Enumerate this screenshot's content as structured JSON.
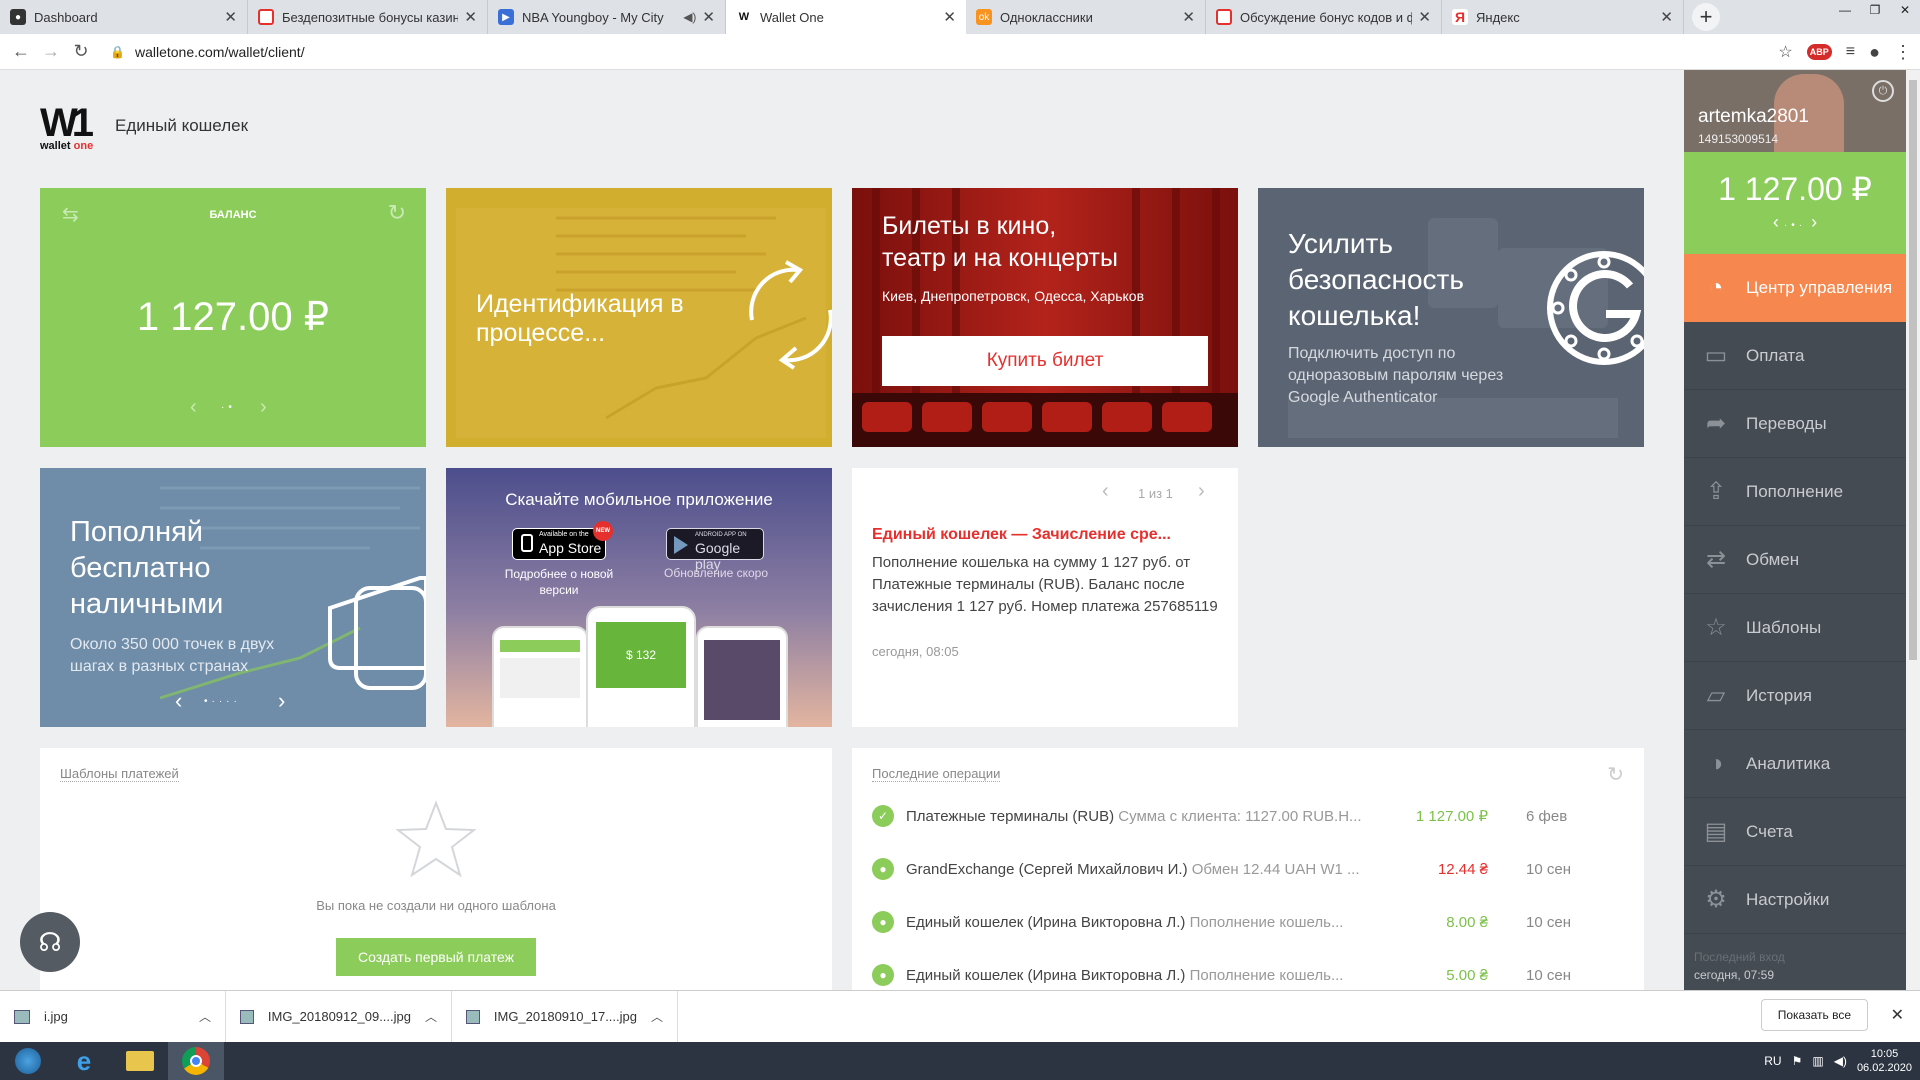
{
  "browser": {
    "tabs": [
      {
        "title": "Dashboard",
        "icon": "github-icon",
        "color": "#333333"
      },
      {
        "title": "Бездепозитные бонусы казино",
        "icon": "spinner-icon",
        "color": "#e5302d"
      },
      {
        "title": "NBA Youngboy - My City",
        "icon": "video-icon",
        "color": "#3a6fd8"
      },
      {
        "title": "Wallet One",
        "icon": "walletone-icon",
        "color": "#111111"
      },
      {
        "title": "Одноклассники",
        "icon": "ok-icon",
        "color": "#f7931e"
      },
      {
        "title": "Обсуждение бонус кодов и фр",
        "icon": "spinner-icon",
        "color": "#e5302d"
      },
      {
        "title": "Яндекс",
        "icon": "yandex-icon",
        "color": "#e5302d"
      }
    ],
    "url": "walletone.com/wallet/client/"
  },
  "header": {
    "logo_mark": "W1",
    "logo_text": "wallet",
    "logo_text_accent": "one",
    "brand": "Единый кошелек"
  },
  "tiles": {
    "balance": {
      "label": "БАЛАНС",
      "amount": "1 127.00 ₽"
    },
    "identification": {
      "text": "Идентификация в процессе..."
    },
    "tickets": {
      "title_line1": "Билеты в кино,",
      "title_line2": "театр и на концерты",
      "cities": "Киев, Днепропетровск, Одесса, Харьков",
      "button": "Купить билет"
    },
    "security": {
      "title_line1": "Усилить",
      "title_line2": "безопасность",
      "title_line3": "кошелька!",
      "text": "Подключить доступ по одноразовым паролям через Google Authenticator"
    },
    "cash": {
      "title_line1": "Пополняй",
      "title_line2": "бесплатно",
      "title_line3": "наличными",
      "text": "Около 350 000 точек в двух шагах в разных странах"
    },
    "mobile": {
      "title": "Скачайте мобильное приложение",
      "appstore_small": "Available on the",
      "appstore": "App Store",
      "new_badge": "NEW",
      "appstore_caption": "Подробнее о новой версии",
      "gplay_small": "ANDROID APP ON",
      "gplay": "Google play",
      "gplay_caption": "Обновление скоро",
      "phone_amount": "$ 132"
    },
    "notice": {
      "pager": "1 из 1",
      "title": "Единый кошелек — Зачисление сре...",
      "body": "Пополнение кошелька на сумму 1 127 руб. от Платежные терминалы (RUB). Баланс после зачисления 1 127 руб. Номер платежа 257685119",
      "time": "сегодня, 08:05"
    }
  },
  "templates": {
    "title": "Шаблоны платежей",
    "empty": "Вы пока не создали ни одного шаблона",
    "button": "Создать первый платеж"
  },
  "operations": {
    "title": "Последние операции",
    "rows": [
      {
        "name": "Платежные терминалы (RUB)",
        "desc": "Сумма с клиента: 1127.00 RUB.Н...",
        "amount": "1 127.00 ₽",
        "date": "6 фев",
        "kind": "in"
      },
      {
        "name": "GrandExchange (Сергей Михайлович И.)",
        "desc": "Обмен 12.44 UAH W1 ...",
        "amount": "12.44 ₴",
        "date": "10 сен",
        "kind": "out"
      },
      {
        "name": "Единый кошелек (Ирина Викторовна Л.)",
        "desc": "Пополнение кошель...",
        "amount": "8.00 ₴",
        "date": "10 сен",
        "kind": "in"
      },
      {
        "name": "Единый кошелек (Ирина Викторовна Л.)",
        "desc": "Пополнение кошель...",
        "amount": "5.00 ₴",
        "date": "10 сен",
        "kind": "in"
      }
    ]
  },
  "sidebar": {
    "username": "artemka2801",
    "user_id": "149153009514",
    "balance": "1 127.00 ₽",
    "items": [
      {
        "label": "Центр управления",
        "icon": "dashboard-icon"
      },
      {
        "label": "Оплата",
        "icon": "payment-icon"
      },
      {
        "label": "Переводы",
        "icon": "transfer-icon"
      },
      {
        "label": "Пополнение",
        "icon": "topup-icon"
      },
      {
        "label": "Обмен",
        "icon": "exchange-icon"
      },
      {
        "label": "Шаблоны",
        "icon": "star-icon"
      },
      {
        "label": "История",
        "icon": "history-icon"
      },
      {
        "label": "Аналитика",
        "icon": "analytics-icon"
      },
      {
        "label": "Счета",
        "icon": "briefcase-icon"
      },
      {
        "label": "Настройки",
        "icon": "gear-icon"
      }
    ],
    "last_login_label": "Последний вход",
    "last_login": "сегодня, 07:59"
  },
  "downloads": {
    "items": [
      "i.jpg",
      "IMG_20180912_09....jpg",
      "IMG_20180910_17....jpg"
    ],
    "show_all": "Показать все"
  },
  "taskbar": {
    "lang": "RU",
    "time": "10:05",
    "date": "06.02.2020"
  },
  "colors": {
    "green": "#8ccc5a",
    "orange": "#f5874f",
    "red": "#e5302d",
    "sidebar": "#454b52"
  }
}
